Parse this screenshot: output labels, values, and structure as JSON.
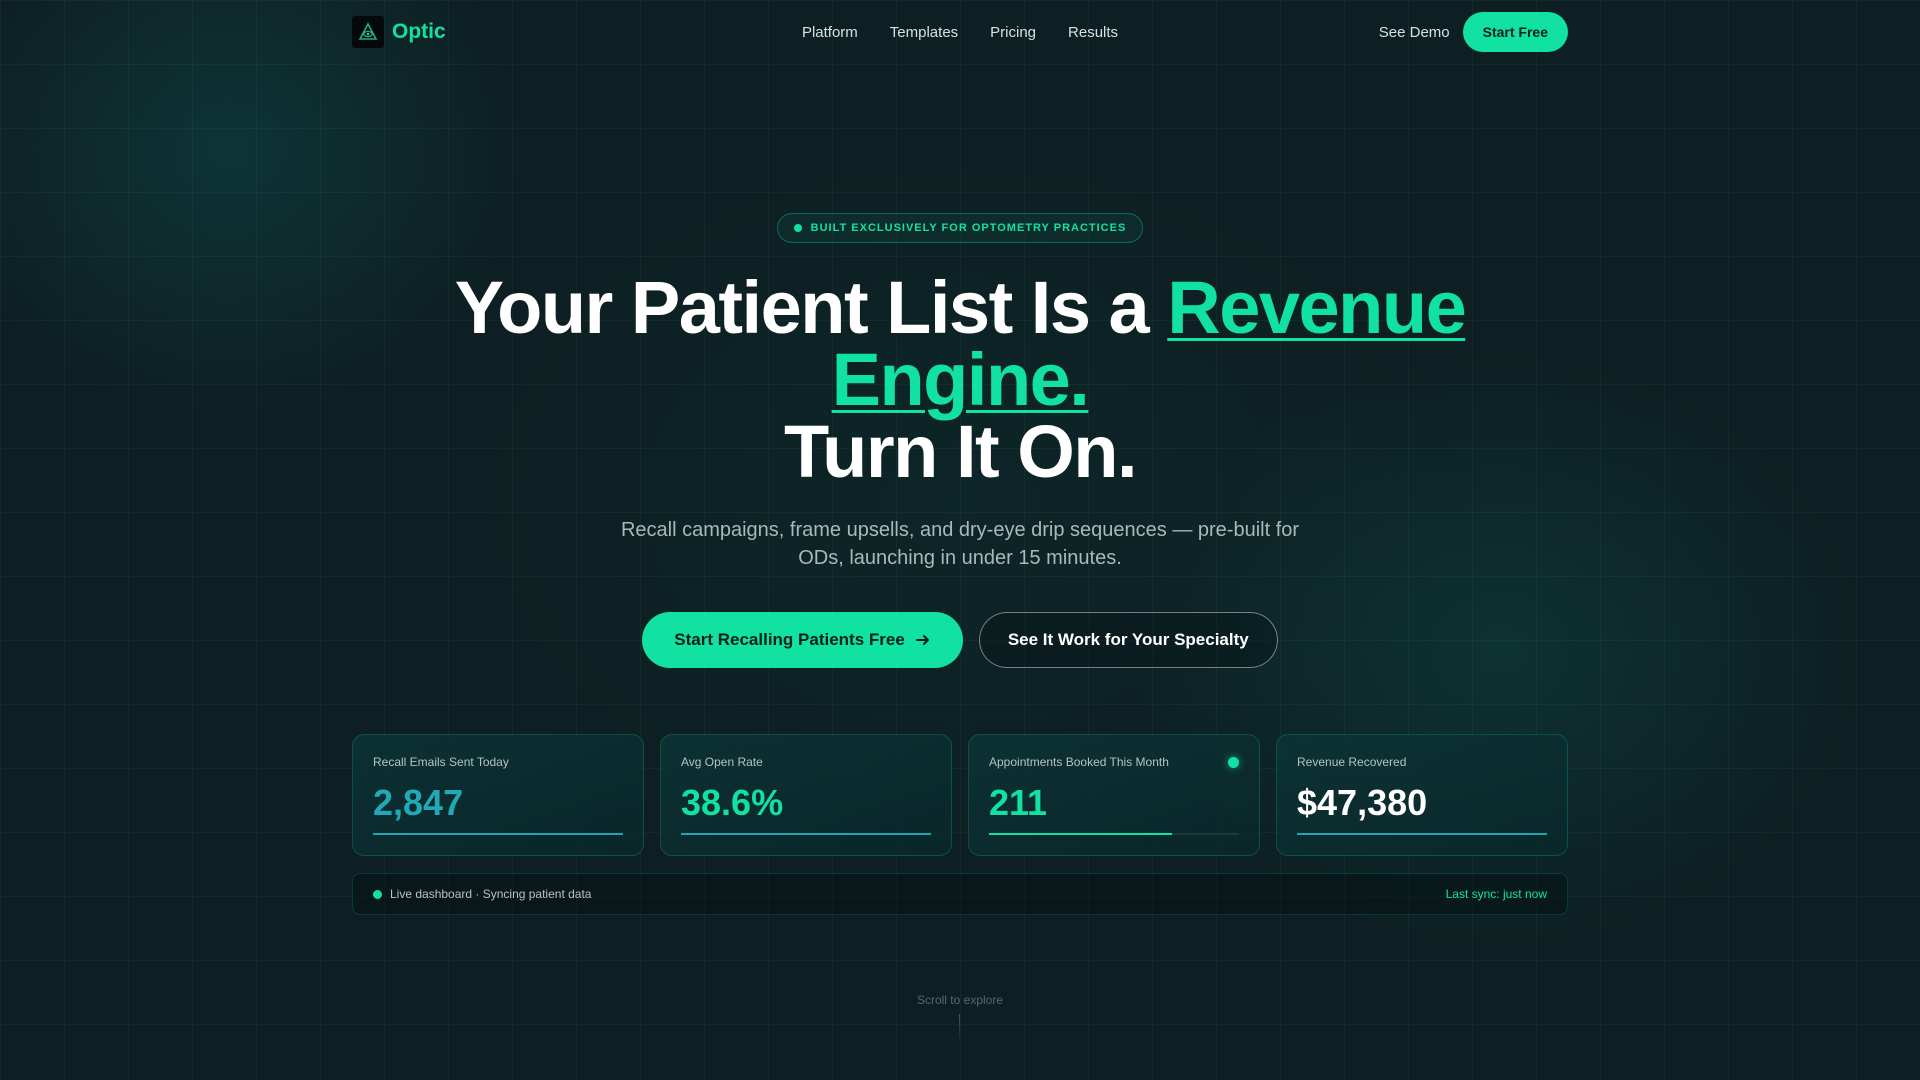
{
  "nav": {
    "brand": "Optic",
    "brand_icon": "eye-triangle-logo-icon",
    "links": [
      "Platform",
      "Templates",
      "Pricing",
      "Results"
    ],
    "see_demo": "See Demo",
    "start_free": "Start Free"
  },
  "hero": {
    "badge": "BUILT EXCLUSIVELY FOR OPTOMETRY PRACTICES",
    "headline_part1": "Your Patient List Is a ",
    "headline_accent": "Revenue Engine.",
    "headline_part2": "Turn It On.",
    "subhead": "Recall campaigns, frame upsells, and dry-eye drip sequences — pre-built for ODs, launching in under 15 minutes.",
    "cta_primary": "Start Recalling Patients Free",
    "cta_primary_icon": "arrow-right-icon",
    "cta_secondary": "See It Work for Your Specialty"
  },
  "stats": [
    {
      "label": "Recall Emails Sent Today",
      "value": "2,847",
      "color": "#22a9b8",
      "progress": 1.0,
      "bar_color": "#1fa7b0"
    },
    {
      "label": "Avg Open Rate",
      "value": "38.6%",
      "color": "#12e2a1",
      "progress": 1.0,
      "bar_color": "#1fa7b0"
    },
    {
      "label": "Appointments Booked This Month",
      "value": "211",
      "color": "#12e2a1",
      "progress": 0.73,
      "bar_color": "#12e2a1",
      "live": true
    },
    {
      "label": "Revenue Recovered",
      "value": "$47,380",
      "color": "#ffffff",
      "progress": 1.0,
      "bar_color": "#1fa7b0"
    }
  ],
  "live": {
    "status": "Live dashboard · Syncing patient data",
    "last_sync": "Last sync: just now"
  },
  "scroll_hint": "Scroll to explore",
  "colors": {
    "accent": "#12e2a1",
    "background": "#0d1f22",
    "teal": "#22a9b8"
  }
}
